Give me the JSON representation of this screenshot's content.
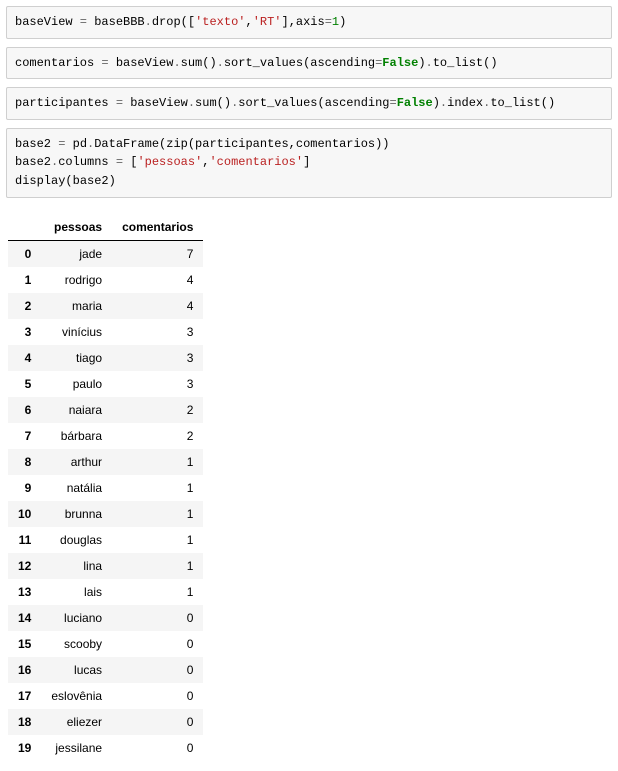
{
  "cells": {
    "c1": {
      "var": "baseView",
      "eq": " = ",
      "obj": "baseBBB",
      "dot1": ".",
      "fn": "drop",
      "open": "([",
      "s1": "'texto'",
      "comma": ",",
      "s2": "'RT'",
      "close1": "],",
      "kw": "axis",
      "eq2": "=",
      "num": "1",
      "close2": ")"
    },
    "c2": {
      "var": "comentarios",
      "eq": " = ",
      "obj": "baseView",
      "dot1": ".",
      "fn1": "sum",
      "paren1": "()",
      "dot2": ".",
      "fn2": "sort_values",
      "open": "(",
      "kw": "ascending",
      "eq2": "=",
      "bool": "False",
      "close": ")",
      "dot3": ".",
      "fn3": "to_list",
      "paren3": "()"
    },
    "c3": {
      "var": "participantes",
      "eq": " = ",
      "obj": "baseView",
      "dot1": ".",
      "fn1": "sum",
      "paren1": "()",
      "dot2": ".",
      "fn2": "sort_values",
      "open": "(",
      "kw": "ascending",
      "eq2": "=",
      "bool": "False",
      "close": ")",
      "dot3": ".",
      "attr": "index",
      "dot4": ".",
      "fn3": "to_list",
      "paren3": "()"
    },
    "c4": {
      "l1_var": "base2",
      "l1_eq": " = ",
      "l1_obj": "pd",
      "l1_dot": ".",
      "l1_cls": "DataFrame",
      "l1_open": "(",
      "l1_zip": "zip",
      "l1_args": "(participantes,comentarios))",
      "l2_obj": "base2",
      "l2_dot": ".",
      "l2_attr": "columns",
      "l2_eq": " = ",
      "l2_open": "[",
      "l2_s1": "'pessoas'",
      "l2_comma": ",",
      "l2_s2": "'comentarios'",
      "l2_close": "]",
      "l3_fn": "display",
      "l3_open": "(",
      "l3_arg": "base2",
      "l3_close": ")"
    }
  },
  "table": {
    "columns": [
      "pessoas",
      "comentarios"
    ],
    "rows": [
      {
        "idx": "0",
        "pessoas": "jade",
        "comentarios": "7"
      },
      {
        "idx": "1",
        "pessoas": "rodrigo",
        "comentarios": "4"
      },
      {
        "idx": "2",
        "pessoas": "maria",
        "comentarios": "4"
      },
      {
        "idx": "3",
        "pessoas": "vinícius",
        "comentarios": "3"
      },
      {
        "idx": "4",
        "pessoas": "tiago",
        "comentarios": "3"
      },
      {
        "idx": "5",
        "pessoas": "paulo",
        "comentarios": "3"
      },
      {
        "idx": "6",
        "pessoas": "naiara",
        "comentarios": "2"
      },
      {
        "idx": "7",
        "pessoas": "bárbara",
        "comentarios": "2"
      },
      {
        "idx": "8",
        "pessoas": "arthur",
        "comentarios": "1"
      },
      {
        "idx": "9",
        "pessoas": "natália",
        "comentarios": "1"
      },
      {
        "idx": "10",
        "pessoas": "brunna",
        "comentarios": "1"
      },
      {
        "idx": "11",
        "pessoas": "douglas",
        "comentarios": "1"
      },
      {
        "idx": "12",
        "pessoas": "lina",
        "comentarios": "1"
      },
      {
        "idx": "13",
        "pessoas": "lais",
        "comentarios": "1"
      },
      {
        "idx": "14",
        "pessoas": "luciano",
        "comentarios": "0"
      },
      {
        "idx": "15",
        "pessoas": "scooby",
        "comentarios": "0"
      },
      {
        "idx": "16",
        "pessoas": "lucas",
        "comentarios": "0"
      },
      {
        "idx": "17",
        "pessoas": "eslovênia",
        "comentarios": "0"
      },
      {
        "idx": "18",
        "pessoas": "eliezer",
        "comentarios": "0"
      },
      {
        "idx": "19",
        "pessoas": "jessilane",
        "comentarios": "0"
      }
    ]
  }
}
